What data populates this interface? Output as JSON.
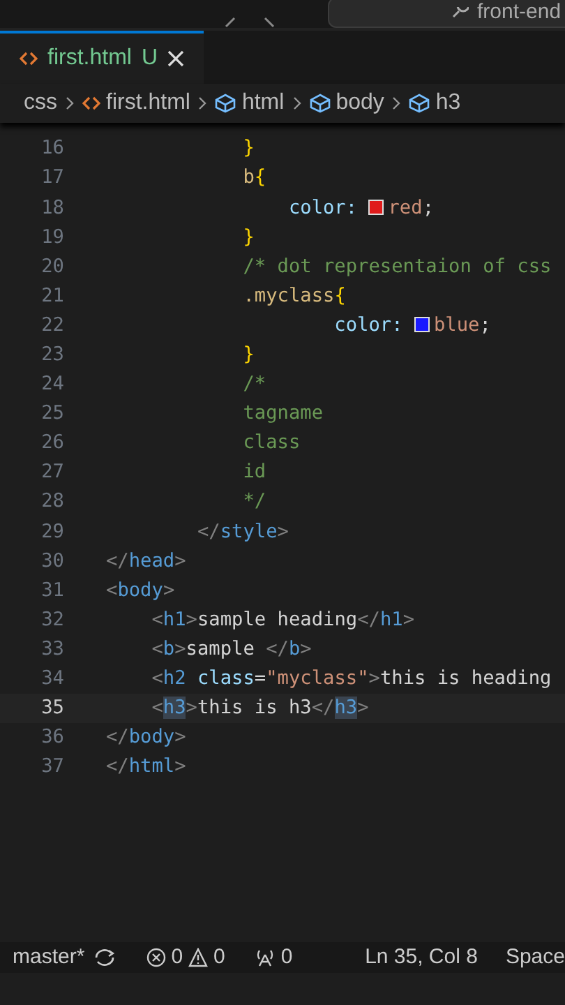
{
  "title_bar": {
    "search": "front-end"
  },
  "tabs": [
    {
      "label": "first.html",
      "badge": "U",
      "selected": true
    }
  ],
  "breadcrumbs": [
    {
      "label": "css",
      "kind": "folder"
    },
    {
      "label": "first.html",
      "kind": "file"
    },
    {
      "label": "html",
      "kind": "symbol"
    },
    {
      "label": "body",
      "kind": "symbol"
    },
    {
      "label": "h3",
      "kind": "symbol"
    }
  ],
  "editor": {
    "lines": [
      {
        "number": "16",
        "current": false,
        "tokens": [
          {
            "kind": "brace",
            "text": "            }"
          }
        ]
      },
      {
        "number": "17",
        "current": false,
        "tokens": [
          {
            "kind": "selector",
            "text": "            b"
          },
          {
            "kind": "brace",
            "text": "{"
          }
        ]
      },
      {
        "number": "18",
        "current": false,
        "tokens": [
          {
            "kind": "property",
            "text": "                color: "
          },
          {
            "kind": "swatch",
            "color": "#e01b1b"
          },
          {
            "kind": "value",
            "text": "red"
          },
          {
            "kind": "text",
            "text": ";"
          }
        ]
      },
      {
        "number": "19",
        "current": false,
        "tokens": [
          {
            "kind": "brace",
            "text": "            }"
          }
        ]
      },
      {
        "number": "20",
        "current": false,
        "tokens": [
          {
            "kind": "comment",
            "text": "            /* dot representaion of css"
          }
        ]
      },
      {
        "number": "21",
        "current": false,
        "tokens": [
          {
            "kind": "selector",
            "text": "            .myclass"
          },
          {
            "kind": "brace",
            "text": "{"
          }
        ]
      },
      {
        "number": "22",
        "current": false,
        "tokens": [
          {
            "kind": "property",
            "text": "                    color: "
          },
          {
            "kind": "swatch",
            "color": "#1a1aff"
          },
          {
            "kind": "value",
            "text": "blue"
          },
          {
            "kind": "text",
            "text": ";"
          }
        ]
      },
      {
        "number": "23",
        "current": false,
        "tokens": [
          {
            "kind": "brace",
            "text": "            }"
          }
        ]
      },
      {
        "number": "24",
        "current": false,
        "tokens": [
          {
            "kind": "comment",
            "text": "            /*"
          }
        ]
      },
      {
        "number": "25",
        "current": false,
        "tokens": [
          {
            "kind": "comment",
            "text": "            tagname"
          }
        ]
      },
      {
        "number": "26",
        "current": false,
        "tokens": [
          {
            "kind": "comment",
            "text": "            class"
          }
        ]
      },
      {
        "number": "27",
        "current": false,
        "tokens": [
          {
            "kind": "comment",
            "text": "            id"
          }
        ]
      },
      {
        "number": "28",
        "current": false,
        "tokens": [
          {
            "kind": "comment",
            "text": "            */"
          }
        ]
      },
      {
        "number": "29",
        "current": false,
        "tokens": [
          {
            "kind": "punct",
            "text": "        </"
          },
          {
            "kind": "tag",
            "text": "style"
          },
          {
            "kind": "punct",
            "text": ">"
          }
        ]
      },
      {
        "number": "30",
        "current": false,
        "tokens": [
          {
            "kind": "punct",
            "text": "</"
          },
          {
            "kind": "tag",
            "text": "head"
          },
          {
            "kind": "punct",
            "text": ">"
          }
        ]
      },
      {
        "number": "31",
        "current": false,
        "tokens": [
          {
            "kind": "punct",
            "text": "<"
          },
          {
            "kind": "tag",
            "text": "body"
          },
          {
            "kind": "punct",
            "text": ">"
          }
        ]
      },
      {
        "number": "32",
        "current": false,
        "tokens": [
          {
            "kind": "punct",
            "text": "    <"
          },
          {
            "kind": "tag",
            "text": "h1"
          },
          {
            "kind": "punct",
            "text": ">"
          },
          {
            "kind": "text",
            "text": "sample heading"
          },
          {
            "kind": "punct",
            "text": "</"
          },
          {
            "kind": "tag",
            "text": "h1"
          },
          {
            "kind": "punct",
            "text": ">"
          }
        ]
      },
      {
        "number": "33",
        "current": false,
        "tokens": [
          {
            "kind": "punct",
            "text": "    <"
          },
          {
            "kind": "tag",
            "text": "b"
          },
          {
            "kind": "punct",
            "text": ">"
          },
          {
            "kind": "text",
            "text": "sample "
          },
          {
            "kind": "punct",
            "text": "</"
          },
          {
            "kind": "tag",
            "text": "b"
          },
          {
            "kind": "punct",
            "text": ">"
          }
        ]
      },
      {
        "number": "34",
        "current": false,
        "tokens": [
          {
            "kind": "punct",
            "text": "    <"
          },
          {
            "kind": "tag",
            "text": "h2"
          },
          {
            "kind": "attr",
            "text": " class"
          },
          {
            "kind": "text",
            "text": "="
          },
          {
            "kind": "string",
            "text": "\"myclass\""
          },
          {
            "kind": "punct",
            "text": ">"
          },
          {
            "kind": "text",
            "text": "this is heading"
          }
        ]
      },
      {
        "number": "35",
        "current": true,
        "tokens": [
          {
            "kind": "punct",
            "text": "    <"
          },
          {
            "kind": "tag",
            "text": "h3",
            "highlighted": true
          },
          {
            "kind": "punct",
            "text": ">"
          },
          {
            "kind": "text",
            "text": "this is h3"
          },
          {
            "kind": "punct",
            "text": "</"
          },
          {
            "kind": "tag",
            "text": "h3",
            "highlighted": true
          },
          {
            "kind": "punct",
            "text": ">"
          }
        ]
      },
      {
        "number": "36",
        "current": false,
        "tokens": [
          {
            "kind": "punct",
            "text": "</"
          },
          {
            "kind": "tag",
            "text": "body"
          },
          {
            "kind": "punct",
            "text": ">"
          }
        ]
      },
      {
        "number": "37",
        "current": false,
        "tokens": [
          {
            "kind": "punct",
            "text": "</"
          },
          {
            "kind": "tag",
            "text": "html"
          },
          {
            "kind": "punct",
            "text": ">"
          }
        ]
      }
    ]
  },
  "status_bar": {
    "branch": "master*",
    "errors": "0",
    "warnings": "0",
    "ports": "0",
    "position": "Ln 35, Col 8",
    "indent": "Space"
  }
}
